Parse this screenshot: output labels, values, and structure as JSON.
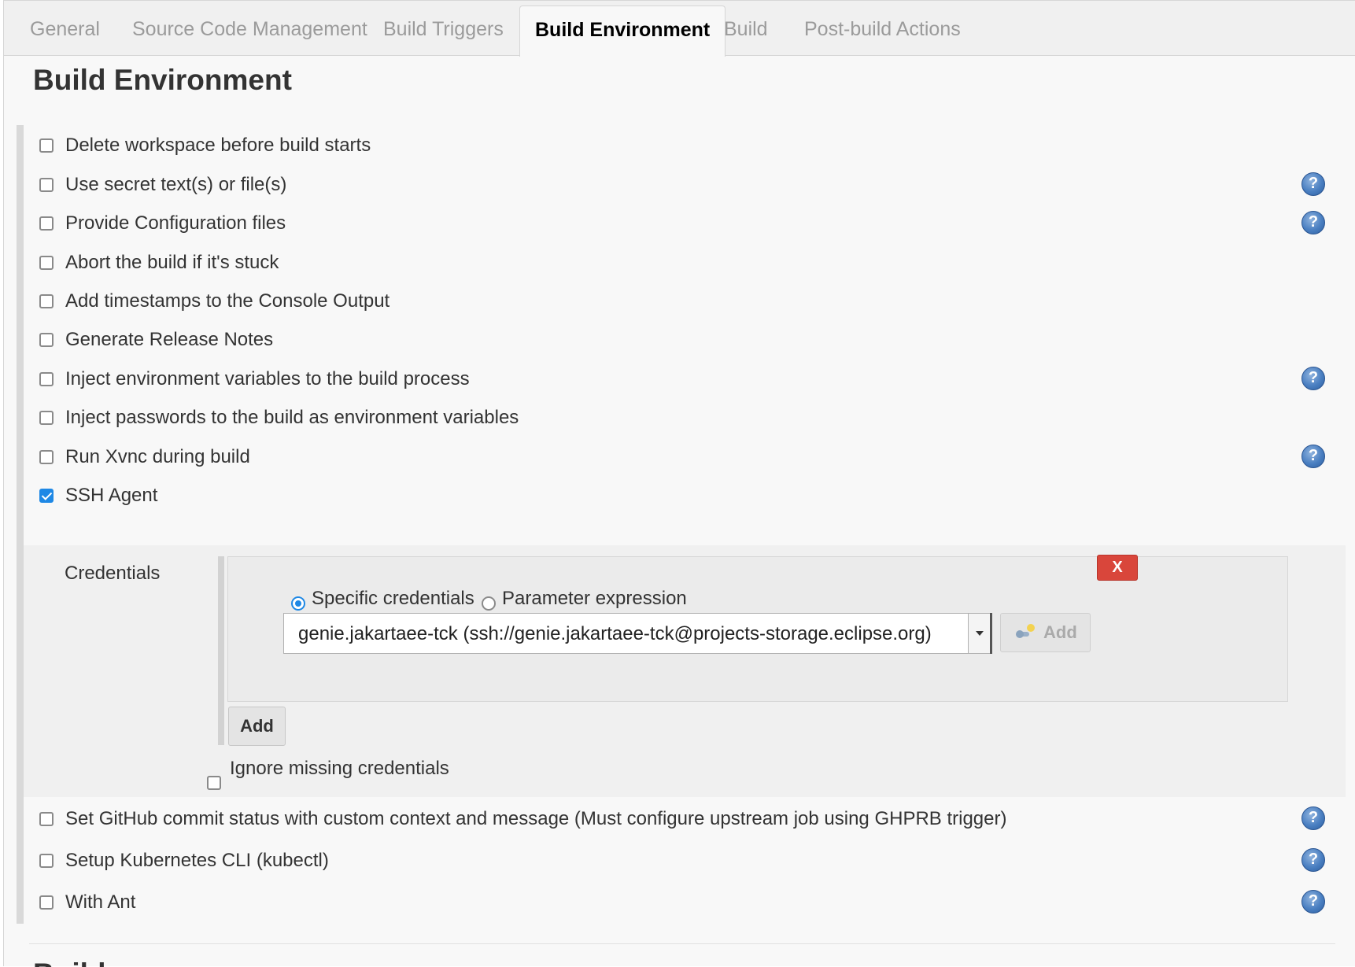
{
  "tabs": [
    {
      "label": "General",
      "active": false
    },
    {
      "label": "Source Code Management",
      "active": false
    },
    {
      "label": "Build Triggers",
      "active": false
    },
    {
      "label": "Build Environment",
      "active": true
    },
    {
      "label": "Build",
      "active": false
    },
    {
      "label": "Post-build Actions",
      "active": false
    }
  ],
  "section_title": "Build Environment",
  "options": [
    {
      "label": "Delete workspace before build starts",
      "checked": false,
      "help": false
    },
    {
      "label": "Use secret text(s) or file(s)",
      "checked": false,
      "help": true
    },
    {
      "label": "Provide Configuration files",
      "checked": false,
      "help": true
    },
    {
      "label": "Abort the build if it's stuck",
      "checked": false,
      "help": false
    },
    {
      "label": "Add timestamps to the Console Output",
      "checked": false,
      "help": false
    },
    {
      "label": "Generate Release Notes",
      "checked": false,
      "help": false
    },
    {
      "label": "Inject environment variables to the build process",
      "checked": false,
      "help": true
    },
    {
      "label": "Inject passwords to the build as environment variables",
      "checked": false,
      "help": false
    },
    {
      "label": "Run Xvnc during build",
      "checked": false,
      "help": true
    },
    {
      "label": "SSH Agent",
      "checked": true,
      "help": false
    },
    {
      "label": "Set GitHub commit status with custom context and message (Must configure upstream job using GHPRB trigger)",
      "checked": false,
      "help": true
    },
    {
      "label": "Setup Kubernetes CLI (kubectl)",
      "checked": false,
      "help": true
    },
    {
      "label": "With Ant",
      "checked": false,
      "help": true
    }
  ],
  "ssh_agent": {
    "credentials_label": "Credentials",
    "radio_specific": "Specific credentials",
    "radio_parameter": "Parameter expression",
    "selected_credential": "genie.jakartaee-tck (ssh://genie.jakartaee-tck@projects-storage.eclipse.org)",
    "key_add_label": "Add",
    "remove_label": "X",
    "add_label": "Add",
    "ignore_missing_label": "Ignore missing credentials"
  },
  "help_glyph": "?",
  "next_section_title": "Build",
  "colors": {
    "accent": "#1e88e5",
    "remove_button": "#d9463b",
    "help_icon": "#4a7fc1"
  }
}
